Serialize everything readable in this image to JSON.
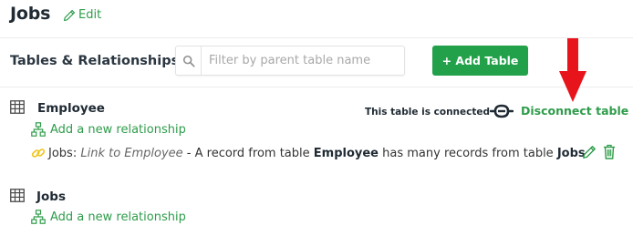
{
  "header": {
    "title": "Jobs",
    "edit_label": "Edit"
  },
  "toolbar": {
    "section_title": "Tables & Relationships",
    "search_placeholder": "Filter by parent table name",
    "add_table_label": "+ Add Table"
  },
  "tables": [
    {
      "name": "Employee",
      "add_relationship_label": "Add a new relationship",
      "connection_status": "This table is connected",
      "disconnect_label": "Disconnect table",
      "relationship": {
        "prefix": "Jobs:",
        "link_name": "Link to Employee",
        "text_a": " - A record from table ",
        "table_a": "Employee",
        "text_b": " has many records from table ",
        "table_b": "Jobs"
      }
    },
    {
      "name": "Jobs",
      "add_relationship_label": "Add a new relationship"
    }
  ],
  "colors": {
    "accent": "#2e9c4a",
    "button": "#22a14a",
    "annotation_arrow": "#e8141c",
    "link_icon": "#f0c419"
  },
  "icons": [
    "pencil-icon",
    "search-icon",
    "table-grid-icon",
    "hierarchy-icon",
    "chain-link-icon",
    "broken-link-icon",
    "trash-icon",
    "red-arrow-annotation"
  ]
}
